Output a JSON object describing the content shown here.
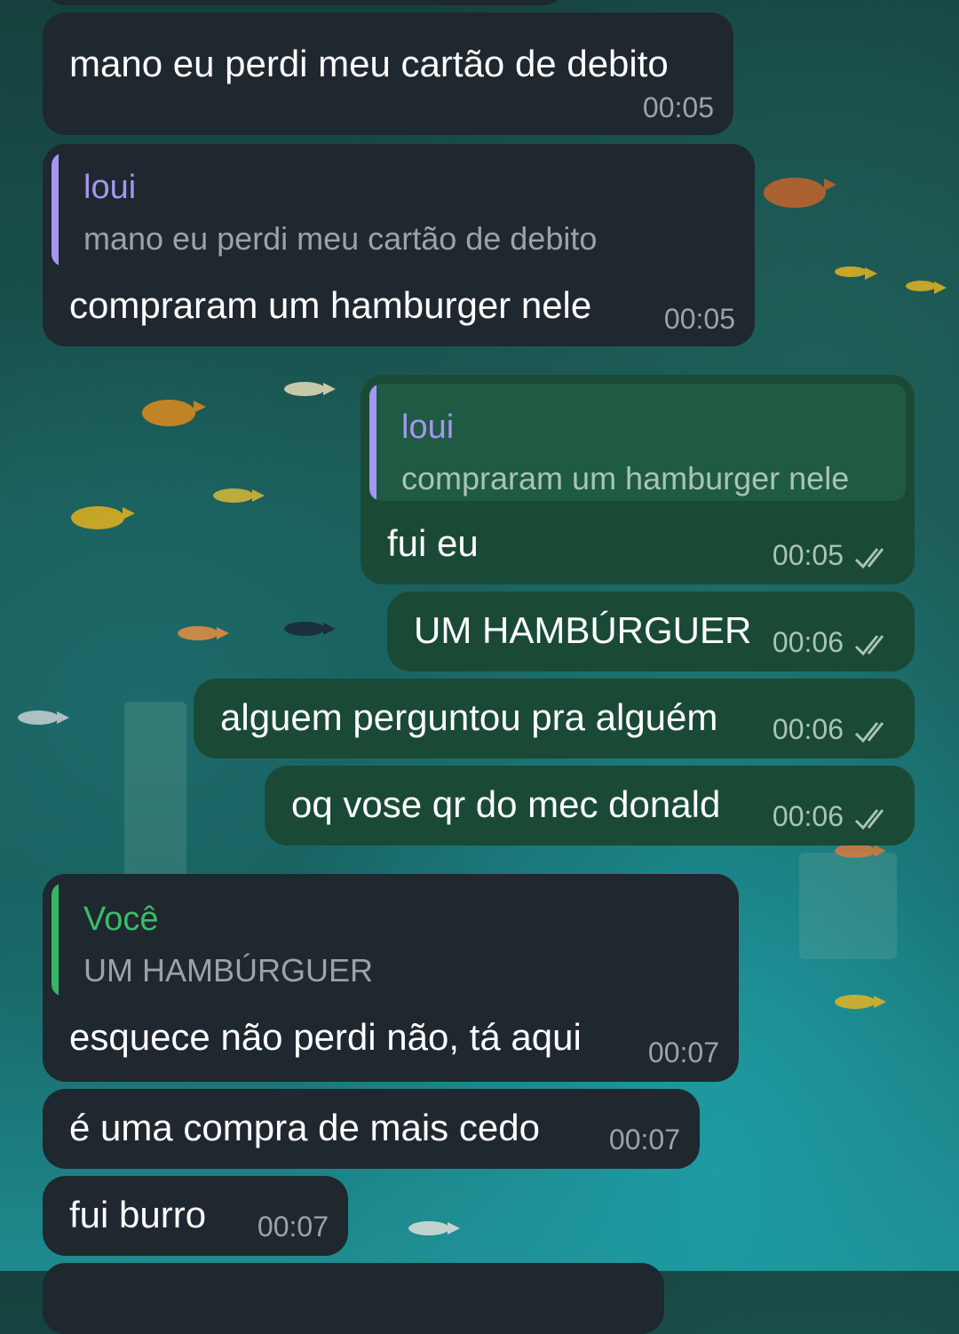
{
  "colors": {
    "incoming_bubble": "#1f272f",
    "outgoing_bubble": "#1a4a35",
    "reply_name_other": "#a596f0",
    "reply_name_self": "#3dbb6b",
    "reply_bar_other": "#a596f0",
    "reply_bar_self": "#35b665"
  },
  "messages": [
    {
      "direction": "in",
      "text": "mano eu perdi meu cartão de debito",
      "time": "00:05"
    },
    {
      "direction": "in",
      "reply_name": "loui",
      "reply_text": "mano eu perdi meu cartão de debito",
      "text": "compraram um hamburger nele",
      "time": "00:05"
    },
    {
      "direction": "out",
      "reply_name": "loui",
      "reply_text": "compraram um hamburger nele",
      "text": "fui eu",
      "time": "00:05",
      "status_icon": "double-check-icon"
    },
    {
      "direction": "out",
      "text": "UM HAMBÚRGUER",
      "time": "00:06",
      "status_icon": "double-check-icon"
    },
    {
      "direction": "out",
      "text": "alguem perguntou pra alguém",
      "time": "00:06",
      "status_icon": "double-check-icon"
    },
    {
      "direction": "out",
      "text": "oq vose qr do mec donald",
      "time": "00:06",
      "status_icon": "double-check-icon"
    },
    {
      "direction": "in",
      "reply_name": "Você",
      "reply_text": "UM HAMBÚRGUER",
      "text": "esquece não perdi não, tá aqui",
      "time": "00:07"
    },
    {
      "direction": "in",
      "text": "é uma compra de mais cedo",
      "time": "00:07"
    },
    {
      "direction": "in",
      "text": "fui burro",
      "time": "00:07"
    }
  ]
}
